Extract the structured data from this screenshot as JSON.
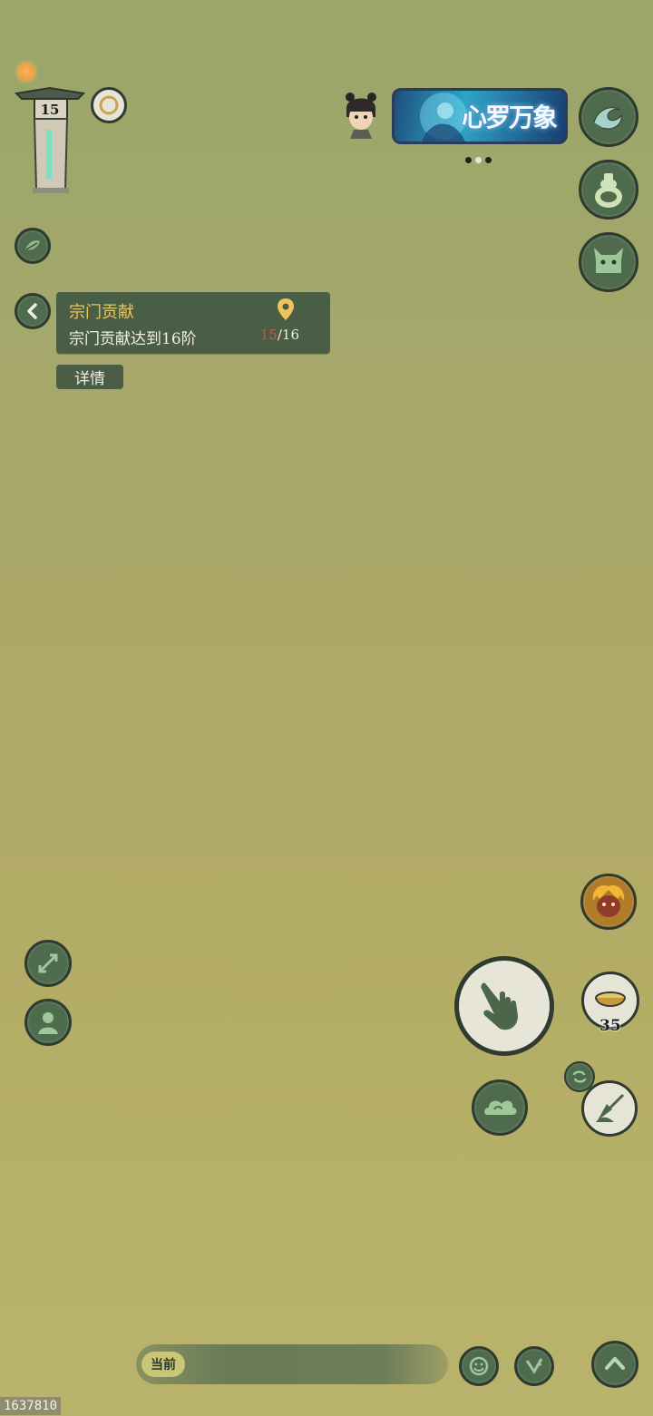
{
  "hud": {
    "level_value": "15"
  },
  "banner": {
    "text": "心罗万象",
    "page_count": 3,
    "active_index": 1
  },
  "quest": {
    "title": "宗门贡献",
    "description": "宗门贡献达到16阶",
    "progress_current": "15",
    "progress_total": "/16",
    "detail_label": "详情"
  },
  "actions": {
    "consumable_count": "35"
  },
  "chat": {
    "channel_label": "当前"
  },
  "watermark": "1637810",
  "colors": {
    "button_fill": "#4f6b4e",
    "quest_title": "#f0c45d",
    "progress_current": "#e04b3a"
  },
  "icons": [
    "sun-icon",
    "pagoda-level-icon",
    "moon-ring-icon",
    "leaf-icon",
    "back-arrow-icon",
    "location-pin-icon",
    "character-avatar-icon",
    "wave-icon",
    "gourd-icon",
    "demon-mask-icon",
    "fire-demon-icon",
    "expand-icon",
    "meditate-icon",
    "hand-touch-icon",
    "food-bowl-icon",
    "cloud-icon",
    "swap-icon",
    "sword-brush-icon",
    "emoji-icon",
    "edit-icon",
    "chevron-up-icon"
  ]
}
